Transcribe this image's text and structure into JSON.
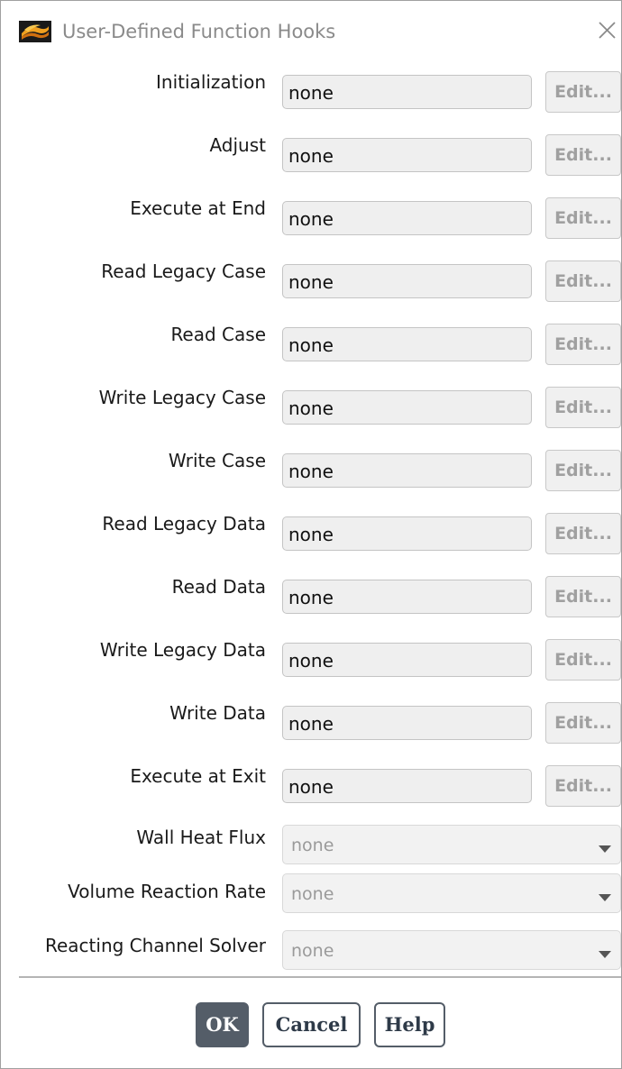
{
  "window": {
    "title": "User-Defined Function Hooks",
    "icon": "fluent-logo-icon",
    "close_icon": "close-icon"
  },
  "hooks": [
    {
      "label": "Initialization",
      "value": "none",
      "edit_label": "Edit..."
    },
    {
      "label": "Adjust",
      "value": "none",
      "edit_label": "Edit..."
    },
    {
      "label": "Execute at End",
      "value": "none",
      "edit_label": "Edit..."
    },
    {
      "label": "Read Legacy Case",
      "value": "none",
      "edit_label": "Edit..."
    },
    {
      "label": "Read Case",
      "value": "none",
      "edit_label": "Edit..."
    },
    {
      "label": "Write Legacy Case",
      "value": "none",
      "edit_label": "Edit..."
    },
    {
      "label": "Write Case",
      "value": "none",
      "edit_label": "Edit..."
    },
    {
      "label": "Read Legacy Data",
      "value": "none",
      "edit_label": "Edit..."
    },
    {
      "label": "Read Data",
      "value": "none",
      "edit_label": "Edit..."
    },
    {
      "label": "Write Legacy Data",
      "value": "none",
      "edit_label": "Edit..."
    },
    {
      "label": "Write Data",
      "value": "none",
      "edit_label": "Edit..."
    },
    {
      "label": "Execute at Exit",
      "value": "none",
      "edit_label": "Edit..."
    }
  ],
  "selects": [
    {
      "label": "Wall Heat Flux",
      "value": "none",
      "icon": "chevron-down-icon"
    },
    {
      "label": "Volume Reaction Rate",
      "value": "none",
      "icon": "chevron-down-icon"
    },
    {
      "label": "Reacting Channel Solver",
      "value": "none",
      "icon": "chevron-down-icon"
    }
  ],
  "footer": {
    "ok_label": "OK",
    "cancel_label": "Cancel",
    "help_label": "Help"
  },
  "colors": {
    "primary_button": "#545d68",
    "field_background": "#efefef",
    "disabled_text": "#a0a0a0"
  }
}
